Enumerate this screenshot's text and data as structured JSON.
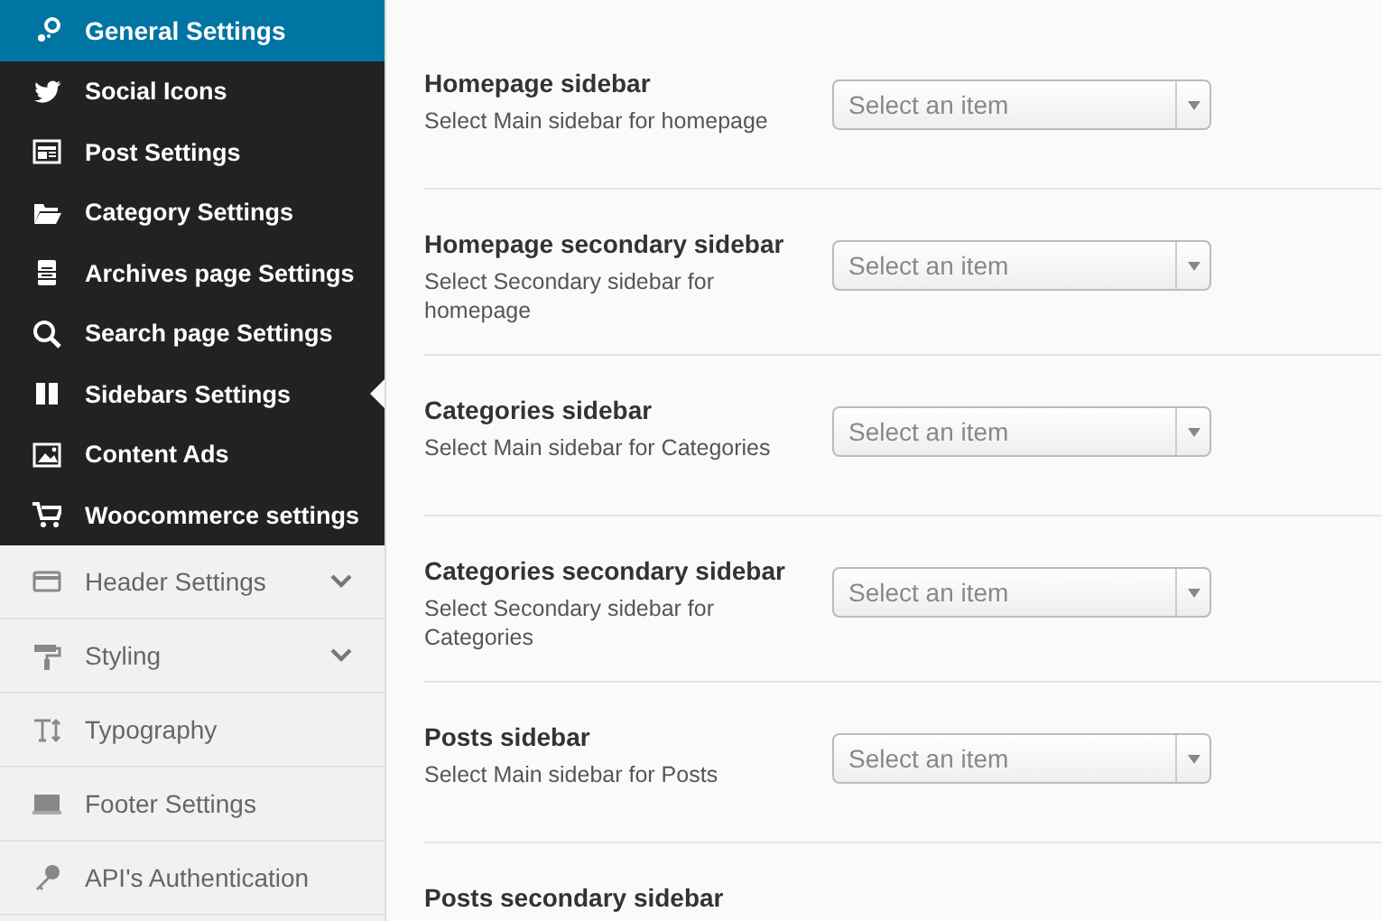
{
  "menu": [
    {
      "label": "General Settings",
      "selected": true,
      "expandable": false,
      "children": [
        {
          "label": "Social Icons",
          "selected": false
        },
        {
          "label": "Post Settings",
          "selected": false
        },
        {
          "label": "Category Settings",
          "selected": false
        },
        {
          "label": "Archives page Settings",
          "selected": false
        },
        {
          "label": "Search page Settings",
          "selected": false
        },
        {
          "label": "Sidebars Settings",
          "selected": true
        },
        {
          "label": "Content Ads",
          "selected": false
        },
        {
          "label": "Woocommerce settings",
          "selected": false
        }
      ]
    },
    {
      "label": "Header Settings",
      "selected": false,
      "expandable": true
    },
    {
      "label": "Styling",
      "selected": false,
      "expandable": true
    },
    {
      "label": "Typography",
      "selected": false,
      "expandable": false
    },
    {
      "label": "Footer Settings",
      "selected": false,
      "expandable": false
    },
    {
      "label": "API's Authentication",
      "selected": false,
      "expandable": false
    }
  ],
  "settings": [
    {
      "title": "Homepage sidebar",
      "description": "Select Main sidebar for homepage",
      "placeholder": "Select an item"
    },
    {
      "title": "Homepage secondary sidebar",
      "description": "Select Secondary sidebar for homepage",
      "placeholder": "Select an item"
    },
    {
      "title": "Categories sidebar",
      "description": "Select Main sidebar for Categories",
      "placeholder": "Select an item"
    },
    {
      "title": "Categories secondary sidebar",
      "description": "Select Secondary sidebar for Categories",
      "placeholder": "Select an item"
    },
    {
      "title": "Posts sidebar",
      "description": "Select Main sidebar for Posts",
      "placeholder": "Select an item"
    },
    {
      "title": "Posts secondary sidebar"
    }
  ]
}
